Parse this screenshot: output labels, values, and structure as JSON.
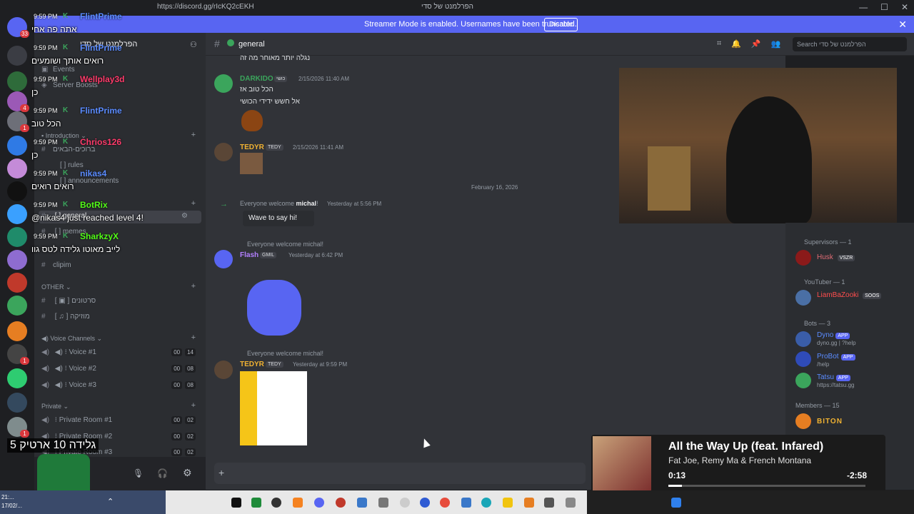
{
  "titlebar": {
    "url": "https://discord.gg/rIcKQ2cEKH",
    "server_title": "הפרלמנט של סדי"
  },
  "banner": {
    "message": "Streamer Mode is enabled. Usernames have been truncated.",
    "button": "Disable"
  },
  "guild_badges": [
    "33",
    "4",
    "1",
    "2",
    "1",
    "3",
    "1"
  ],
  "server": {
    "name": "הפרלמנט של סדי",
    "items": [
      "Events",
      "Server Boosts"
    ],
    "categories": {
      "intro": "Introduction",
      "other": "OTHER",
      "voice": "Voice Channels",
      "private": "Private"
    },
    "channels": {
      "welcome": "ברוכים-הבאים",
      "rules": "rules",
      "announcements": "announcements",
      "general": "general",
      "memes": "memes",
      "clipim": "clipim",
      "sratonim": "סרטונים",
      "music": "מוזיקה"
    },
    "voice": [
      {
        "name": "Voice #1",
        "a": "00",
        "b": "14"
      },
      {
        "name": "Voice #2",
        "a": "00",
        "b": "08"
      },
      {
        "name": "Voice #3",
        "a": "00",
        "b": "08"
      }
    ],
    "private": [
      {
        "name": "Private Room #1",
        "a": "00",
        "b": "02"
      },
      {
        "name": "Private Room #2",
        "a": "00",
        "b": "02"
      },
      {
        "name": "Private Room #3",
        "a": "00",
        "b": "02"
      }
    ]
  },
  "stream_chat": [
    {
      "time": "9:59 PM",
      "name": "FlintPrime",
      "color": "#5b8cff",
      "text": "אתה פה אחי"
    },
    {
      "time": "9:59 PM",
      "name": "FlintPrime",
      "color": "#5b8cff",
      "text": "רואים אותך ושומעים"
    },
    {
      "time": "9:59 PM",
      "name": "Wellplay3d",
      "color": "#ff3b6b",
      "text": "כן"
    },
    {
      "time": "9:59 PM",
      "name": "FlintPrime",
      "color": "#5b8cff",
      "text": "הכל טוב"
    },
    {
      "time": "9:59 PM",
      "name": "Chrios126",
      "color": "#ff3b6b",
      "text": "כן"
    },
    {
      "time": "9:59 PM",
      "name": "nikas4",
      "color": "#5b8cff",
      "text": "רואים רואים"
    },
    {
      "time": "9:59 PM",
      "name": "BotRix",
      "color": "#53fc18",
      "text": "@nikas4 just reached level 4!"
    },
    {
      "time": "9:59 PM",
      "name": "SharkzyX",
      "color": "#53fc18",
      "text": "לייב מאוטו גלידה לטס גוו"
    }
  ],
  "chat": {
    "channel_title": "general",
    "search_placeholder": "Search הפרלמנט של סדי",
    "top_text": "נגלה יותר מאוחר מה זה",
    "messages": [
      {
        "name": "DARKIDO",
        "color": "#3ba55c",
        "tag": "כושי",
        "time": "2/15/2026 11:40 AM",
        "lines": [
          "הכל טוב אז",
          "אל חשש ידידי הכושי"
        ]
      },
      {
        "name": "TEDYR",
        "color": "#f0b232",
        "tag": "TEDY",
        "time": "2/15/2026 11:41 AM"
      }
    ],
    "date_separator": "February 16, 2026",
    "welcome": {
      "prefix": "Everyone welcome ",
      "user": "michal",
      "suffix": "!",
      "time": "Yesterday at 5:56 PM",
      "wave": "Wave to say hi!"
    },
    "reply1": "Everyone welcome michal!",
    "flash": {
      "name": "Flash",
      "tag": "GMIL",
      "time": "Yesterday at 6:42 PM"
    },
    "reply2": "Everyone welcome michal!",
    "tedyr2": {
      "name": "TEDYR",
      "tag": "TEDY",
      "time": "Yesterday at 9:59 PM"
    }
  },
  "members": {
    "supervisors": "Supervisors — 1",
    "husk": {
      "name": "Husk",
      "tag": "VSZR"
    },
    "youtuber": "YouTuber — 1",
    "liam": {
      "name": "LiamBaZooki",
      "tag": "SOOS"
    },
    "bots": "Bots — 3",
    "dyno": {
      "name": "Dyno",
      "sub": "dyno.gg | ?help"
    },
    "probot": {
      "name": "ProBot",
      "sub": "/help"
    },
    "tatsu": {
      "name": "Tatsu",
      "sub": "https://tatsu.gg"
    },
    "app": "APP",
    "members_header": "Members — 15",
    "biton": "BITON"
  },
  "now_playing": {
    "title": "All the Way Up (feat. Infared)",
    "artist": "Fat Joe, Remy Ma & French Montana",
    "current": "0:13",
    "remaining": "-2:58",
    "progress": 0.07
  },
  "caption": "גלידה 10 ארטיק 5",
  "clock": {
    "time": "21:...",
    "date": "17/02/..."
  },
  "colors": {
    "accent": "#5865f2",
    "bg": "#313338",
    "sidebar": "#2b2d31"
  }
}
